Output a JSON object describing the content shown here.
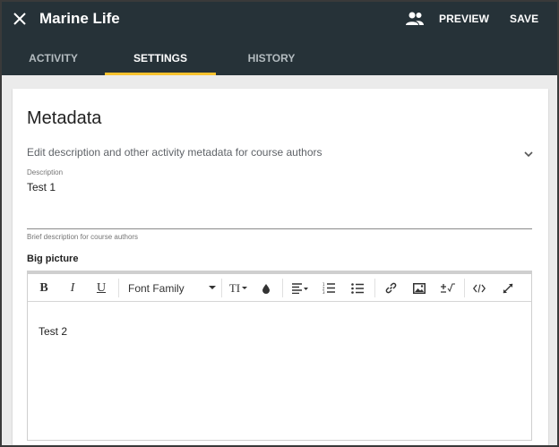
{
  "header": {
    "title": "Marine Life",
    "preview_label": "PREVIEW",
    "save_label": "SAVE",
    "bg_color": "#263238"
  },
  "tabs": [
    {
      "label": "ACTIVITY",
      "active": false
    },
    {
      "label": "SETTINGS",
      "active": true
    },
    {
      "label": "HISTORY",
      "active": false
    }
  ],
  "accent_color": "#f9c22e",
  "metadata": {
    "title": "Metadata",
    "subtitle": "Edit description and other activity metadata for course authors",
    "description": {
      "label": "Description",
      "value": "Test 1",
      "hint": "Brief description for course authors"
    }
  },
  "big_picture": {
    "label": "Big picture",
    "toolbar": {
      "bold": "B",
      "italic": "I",
      "underline": "U",
      "font_family": "Font Family",
      "font_size": "TI"
    },
    "content": "Test 2"
  },
  "icons": {
    "close": "close-icon",
    "people": "people-icon",
    "expand": "chevron-down-icon",
    "toolbar": [
      "bold-icon",
      "italic-icon",
      "underline-icon",
      "font-size-icon",
      "text-color-icon",
      "align-icon",
      "ordered-list-icon",
      "unordered-list-icon",
      "link-icon",
      "image-icon",
      "equation-icon",
      "code-icon",
      "fullscreen-icon"
    ]
  }
}
